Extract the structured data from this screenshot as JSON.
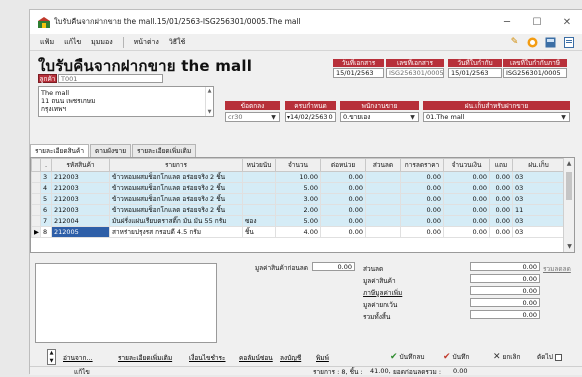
{
  "window": {
    "title": "ใบรับคืนจากฝากขาย the mall.15/01/2563-ISG256301/0005.The mall"
  },
  "menu": [
    "แฟ้ม",
    "แก้ไข",
    "มุมมอง",
    "หน้าต่าง",
    "วิธีใช้"
  ],
  "heading": "ใบรับคืนจากฝากขาย the mall",
  "customer": {
    "label": "ลูกค้า",
    "code": "T001",
    "address": [
      "The mall",
      "11 ถนน เพชรเกษม",
      "กรุงเทพฯ"
    ]
  },
  "doc": {
    "date_label": "วันที่เอกสาร",
    "date": "15/01/2563",
    "no_label": "เลขที่เอกสาร",
    "no": "ISG256301/0005",
    "ref_date_label": "วันที่ใบกำกับ",
    "ref_date": "15/01/2563",
    "ref_no_label": "เลขที่ใบกำกับภาษี",
    "ref_no": "ISG256301/0005"
  },
  "fields": {
    "warehouse_label": "ข้อตกลง",
    "warehouse": "cr30",
    "due_label": "ครบกำหนด",
    "due": "14/02/2563",
    "due_days": "0",
    "sales_label": "พนักงานขาย",
    "sales": "0.ขายเอง",
    "branch_label": "ฝน.เก็บสำหรับฝากขาย",
    "branch": "01.The mall"
  },
  "tabs": [
    "รายละเอียดสินค้า",
    "ตามผังขาย",
    "รายละเอียดเพิ่มเติม"
  ],
  "table": {
    "headers": [
      ".",
      "รหัสสินค้า",
      "รายการ",
      "หน่วยนับ",
      "จำนวน",
      "ต่อหน่วย",
      "ส่วนลด",
      "การลดราคา",
      "จำนวนเงิน",
      "แถม",
      "ฝน.เก็บ"
    ],
    "rows": [
      [
        "",
        "3",
        "212003",
        "ข้าวหอมผสมช็อกโกแลต อร่อยจริง 2 ชิ้น",
        "",
        "10.00",
        "0.00",
        "",
        "0.00",
        "0.00",
        "0.00",
        "03"
      ],
      [
        "",
        "4",
        "212003",
        "ข้าวหอมผสมช็อกโกแลต อร่อยจริง 2 ชิ้น",
        "",
        "5.00",
        "0.00",
        "",
        "0.00",
        "0.00",
        "0.00",
        "03"
      ],
      [
        "",
        "5",
        "212003",
        "ข้าวหอมผสมช็อกโกแลต อร่อยจริง 2 ชิ้น",
        "",
        "3.00",
        "0.00",
        "",
        "0.00",
        "0.00",
        "0.00",
        "03"
      ],
      [
        "",
        "6",
        "212003",
        "ข้าวหอมผสมช็อกโกแลต อร่อยจริง 2 ชิ้น",
        "",
        "2.00",
        "0.00",
        "",
        "0.00",
        "0.00",
        "0.00",
        "11"
      ],
      [
        "",
        "7",
        "212004",
        "มันฝรั่งแผ่นเรียบตราสติ๊ก มัน มัน 55 กรัม",
        "ซอง",
        "5.00",
        "0.00",
        "",
        "0.00",
        "0.00",
        "0.00",
        "03"
      ],
      [
        "▶",
        "8",
        "212005",
        "สาหร่ายปรุงรส กรอบดี 4.5 กรัม",
        "ชิ้น",
        "4.00",
        "0.00",
        "",
        "0.00",
        "0.00",
        "0.00",
        "03"
      ]
    ]
  },
  "totals": {
    "before_discount_label": "มูลค่าสินค้าก่อนลด",
    "before_discount": "0.00",
    "discount_label": "ส่วนลด",
    "discount": "0.00",
    "discount_note": "รวมลดลด",
    "goods_value_label": "มูลค่าสินค้า",
    "goods_value": "0.00",
    "vat_label": "ภาษีมูลค่าเพิ่ม",
    "vat": "0.00",
    "exempt_label": "มูลค่ายกเว้น",
    "exempt": "0.00",
    "total_label": "รวมทั้งสิ้น",
    "total": "0.00"
  },
  "bottom_links": [
    "อ่านจาก...",
    "รายละเอียดเพิ่มเติม",
    "เงื่อนไขชำระ",
    "คอลัมน์ซ่อน",
    "ลงบัญชี",
    "พิมพ์"
  ],
  "buttons": {
    "save_draft": "บันทึกลบ",
    "save": "บันทึก",
    "cancel": "ยกเลิก",
    "continue": "ตัดไป"
  },
  "status": {
    "left": "แก้ไข",
    "items_label": "รายการ : 8, ชิ้น :",
    "qty": "41.00,",
    "net_label": "ยอดก่อนลดรวม :",
    "net": "0.00"
  }
}
